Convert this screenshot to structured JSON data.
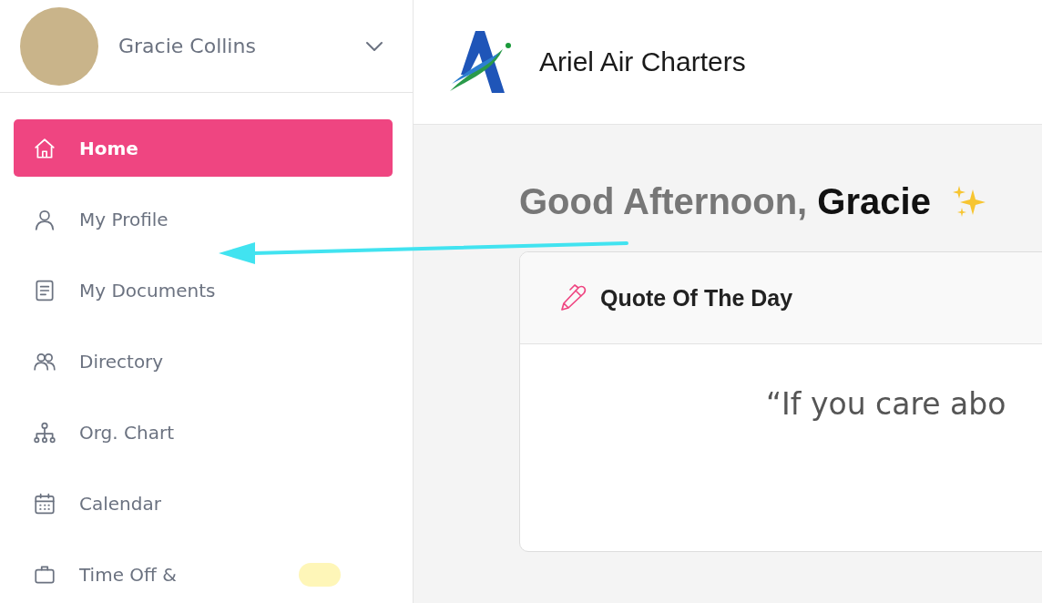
{
  "user": {
    "name": "Gracie Collins"
  },
  "sidebar": {
    "items": [
      {
        "label": "Home",
        "kind": "home",
        "selected": true
      },
      {
        "label": "My Profile",
        "kind": "person",
        "selected": false
      },
      {
        "label": "My Documents",
        "kind": "document",
        "selected": false
      },
      {
        "label": "Directory",
        "kind": "people",
        "selected": false
      },
      {
        "label": "Org. Chart",
        "kind": "org",
        "selected": false
      },
      {
        "label": "Calendar",
        "kind": "calendar",
        "selected": false
      },
      {
        "label": "Time Off &",
        "kind": "briefcase",
        "selected": false,
        "badge": true
      }
    ]
  },
  "header": {
    "company": "Ariel Air Charters"
  },
  "greeting": "Good Afternoon, **Gracie**",
  "quote_card": {
    "title": "Quote Of The Day",
    "quote": "“If you care abo"
  }
}
